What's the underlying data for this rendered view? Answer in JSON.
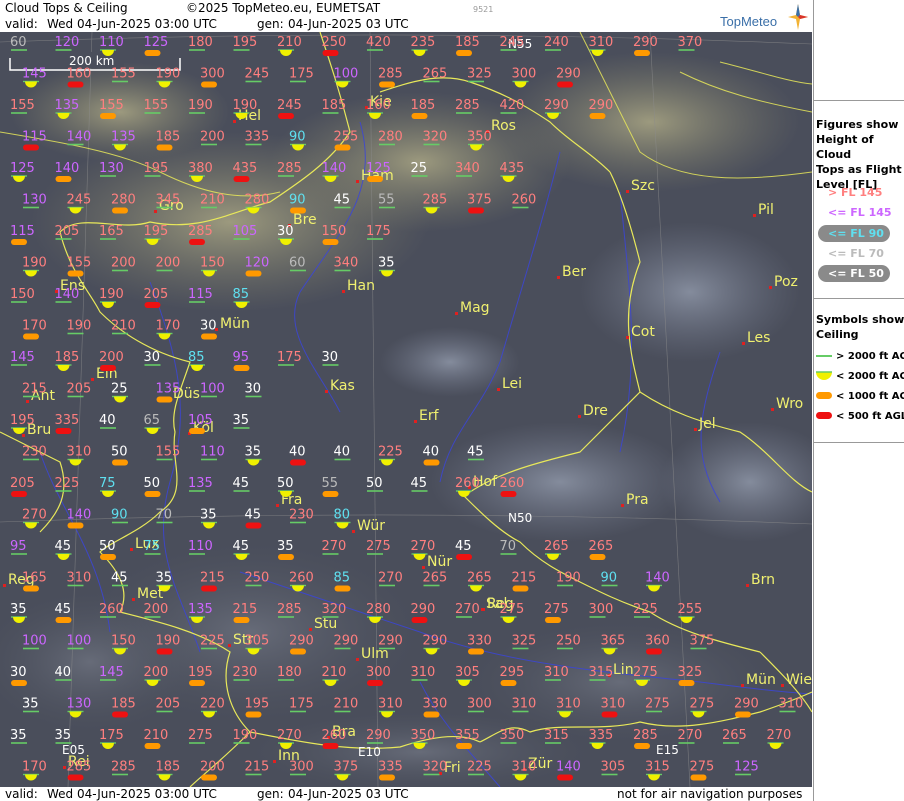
{
  "header": {
    "title": "Cloud Tops & Ceiling",
    "copyright": "©2025 TopMeteo.eu, EUMETSAT",
    "code": "9521",
    "valid_label": "valid:",
    "valid_value": "Wed   04-Jun-2025   03:00 UTC",
    "gen_label": "gen:",
    "gen_value": "04-Jun-2025 03 UTC",
    "logo": "TopMeteo"
  },
  "footer": {
    "valid_label": "valid:",
    "valid_value": "Wed   04-Jun-2025   03:00 UTC",
    "gen_label": "gen:",
    "gen_value": "04-Jun-2025 03 UTC",
    "disclaimer": "not for air navigation purposes"
  },
  "scale": {
    "label": "200 km"
  },
  "legend": {
    "tops_title": [
      "Figures show",
      "Height of Cloud",
      "Tops as Flight",
      "Level  [FL]"
    ],
    "tops_items": [
      {
        "label": "> FL 145",
        "color": "#ff7f7f"
      },
      {
        "label": "<= FL 145",
        "color": "#cc66ff"
      },
      {
        "label": "<= FL 90",
        "color": "#5fe0f0"
      },
      {
        "label": "<= FL 70",
        "color": "#bbbbbb"
      },
      {
        "label": "<= FL 50",
        "color": "#ffffff"
      }
    ],
    "ceiling_title": [
      "Symbols show",
      "Ceiling"
    ],
    "ceiling_items": [
      {
        "label": "> 2000 ft AGL",
        "color": "#66cc66"
      },
      {
        "label": "< 2000 ft AGL",
        "color": "#f0f000"
      },
      {
        "label": "< 1000 ft AGL",
        "color": "#ff9900"
      },
      {
        "label": "< 500 ft AGL",
        "color": "#ee1111"
      }
    ]
  },
  "cities": [
    "Kie",
    "Ros",
    "Szc",
    "Hel",
    "Ham",
    "Bre",
    "Gro",
    "Pil",
    "Ber",
    "Han",
    "Poz",
    "Mag",
    "Lei",
    "Les",
    "Mün",
    "Ens",
    "Cot",
    "Ein",
    "Kas",
    "Dre",
    "Wro",
    "Ant",
    "Düs",
    "Erf",
    "Bru",
    "Köl",
    "Jel",
    "Hof",
    "Fra",
    "Pra",
    "Lux",
    "Wür",
    "Nür",
    "Met",
    "Reg",
    "Brn",
    "Stu",
    "Str",
    "Ulm",
    "Lin",
    "Mün",
    "Wie",
    "Bra",
    "Fri",
    "Inn",
    "Zür",
    "Sal",
    "Reg",
    "Rei",
    "Dij"
  ],
  "grid_labels": [
    "N55",
    "N50",
    "E05",
    "E10",
    "E15"
  ],
  "flight_levels": [
    [
      "60",
      "120",
      "110",
      "125",
      "180",
      "195",
      "210",
      "250",
      "420",
      "235",
      "185",
      "245",
      "240",
      "310",
      "290",
      "370"
    ],
    [
      "145",
      "160",
      "155",
      "190",
      "300",
      "245",
      "175",
      "100",
      "285",
      "265",
      "325",
      "300",
      "290"
    ],
    [
      "155",
      "135",
      "155",
      "155",
      "190",
      "190",
      "245",
      "185",
      "160",
      "185",
      "285",
      "420",
      "290",
      "290"
    ],
    [
      "115",
      "140",
      "135",
      "185",
      "200",
      "335",
      "90",
      "255",
      "280",
      "320",
      "350"
    ],
    [
      "125",
      "140",
      "130",
      "195",
      "380",
      "435",
      "285",
      "140",
      "125",
      "25",
      "340",
      "435"
    ],
    [
      "130",
      "245",
      "280",
      "345",
      "210",
      "280",
      "90",
      "45",
      "55",
      "285",
      "375",
      "260"
    ],
    [
      "115",
      "205",
      "165",
      "195",
      "285",
      "105",
      "30",
      "150",
      "175"
    ],
    [
      "190",
      "155",
      "200",
      "200",
      "150",
      "120",
      "60",
      "340",
      "35"
    ],
    [
      "150",
      "140",
      "190",
      "205",
      "115",
      "85"
    ],
    [
      "170",
      "190",
      "210",
      "170",
      "30"
    ],
    [
      "145",
      "185",
      "200",
      "30",
      "85",
      "95",
      "175",
      "30"
    ],
    [
      "215",
      "205",
      "25",
      "135",
      "100",
      "30"
    ],
    [
      "195",
      "335",
      "40",
      "65",
      "105",
      "35"
    ],
    [
      "230",
      "310",
      "50",
      "155",
      "110",
      "35",
      "40",
      "40",
      "225",
      "40",
      "45"
    ],
    [
      "205",
      "225",
      "75",
      "50",
      "135",
      "45",
      "50",
      "55",
      "50",
      "45",
      "260",
      "260"
    ],
    [
      "270",
      "140",
      "90",
      "70",
      "35",
      "45",
      "230",
      "80"
    ],
    [
      "95",
      "45",
      "50",
      "75",
      "110",
      "45",
      "35",
      "270",
      "275",
      "270",
      "45",
      "70",
      "265",
      "265"
    ],
    [
      "165",
      "310",
      "45",
      "35",
      "215",
      "250",
      "260",
      "85",
      "270",
      "265",
      "265",
      "215",
      "190",
      "90",
      "140"
    ],
    [
      "35",
      "45",
      "260",
      "200",
      "135",
      "215",
      "285",
      "320",
      "280",
      "290",
      "270",
      "275",
      "275",
      "300",
      "225",
      "255"
    ],
    [
      "100",
      "100",
      "150",
      "190",
      "225",
      "305",
      "290",
      "290",
      "290",
      "290",
      "330",
      "325",
      "250",
      "365",
      "360",
      "375"
    ],
    [
      "30",
      "40",
      "145",
      "200",
      "195",
      "230",
      "180",
      "210",
      "300",
      "310",
      "305",
      "295",
      "310",
      "315",
      "275",
      "325"
    ],
    [
      "35",
      "130",
      "185",
      "205",
      "220",
      "195",
      "175",
      "210",
      "310",
      "330",
      "300",
      "310",
      "310",
      "310",
      "275",
      "275",
      "290",
      "310"
    ],
    [
      "35",
      "35",
      "175",
      "210",
      "275",
      "190",
      "270",
      "260",
      "290",
      "350",
      "355",
      "350",
      "315",
      "335",
      "285",
      "270",
      "265",
      "270"
    ],
    [
      "170",
      "285",
      "285",
      "185",
      "200",
      "215",
      "300",
      "375",
      "335",
      "320",
      "225",
      "310",
      "140",
      "305",
      "315",
      "275",
      "125"
    ]
  ]
}
